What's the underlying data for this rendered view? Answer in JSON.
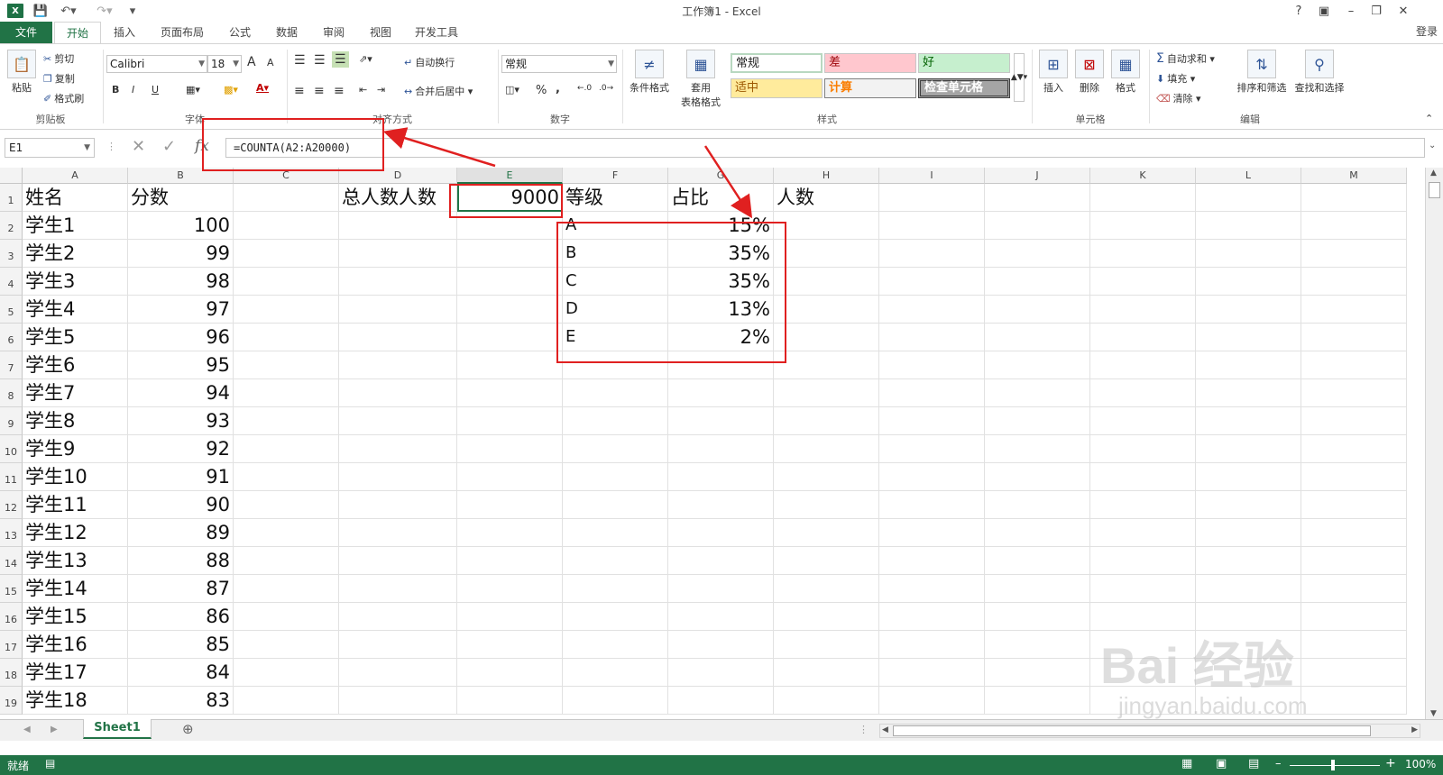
{
  "window": {
    "title": "工作簿1 - Excel",
    "help": "?",
    "login": "登录"
  },
  "ribbon_tabs": [
    "文件",
    "开始",
    "插入",
    "页面布局",
    "公式",
    "数据",
    "审阅",
    "视图",
    "开发工具"
  ],
  "clipboard": {
    "paste": "粘贴",
    "cut": "剪切",
    "copy": "复制",
    "format_painter": "格式刷",
    "label": "剪贴板"
  },
  "font": {
    "name": "Calibri",
    "size": "18",
    "grow": "A",
    "shrink": "A",
    "bold": "B",
    "italic": "I",
    "underline": "U",
    "label": "字体"
  },
  "alignment": {
    "wrap": "自动换行",
    "merge": "合并后居中",
    "label": "对齐方式"
  },
  "number": {
    "format": "常规",
    "percent": "%",
    "comma": ",",
    "label": "数字"
  },
  "styles": {
    "conditional": "条件格式",
    "table_line1": "套用",
    "table_line2": "表格格式",
    "normal": "常规",
    "bad": "差",
    "good": "好",
    "neutral": "适中",
    "calc": "计算",
    "check": "检查单元格",
    "label": "样式"
  },
  "cells_group": {
    "insert": "插入",
    "delete": "删除",
    "format": "格式",
    "label": "单元格"
  },
  "editing": {
    "autosum": "自动求和",
    "fill": "填充",
    "clear": "清除",
    "sort": "排序和筛选",
    "find": "查找和选择",
    "label": "编辑"
  },
  "formula_bar": {
    "name_box": "E1",
    "formula": "=COUNTA(A2:A20000)"
  },
  "columns": [
    "A",
    "B",
    "C",
    "D",
    "E",
    "F",
    "G",
    "H",
    "I",
    "J",
    "K",
    "L",
    "M"
  ],
  "rows": [
    "1",
    "2",
    "3",
    "4",
    "5",
    "6",
    "7",
    "8",
    "9",
    "10",
    "11",
    "12",
    "13",
    "14",
    "15",
    "16",
    "17",
    "18",
    "19"
  ],
  "sheet": {
    "A1": "姓名",
    "B1": "分数",
    "D1": "总人数人数",
    "E1": "9000",
    "F1": "等级",
    "G1": "占比",
    "H1": "人数",
    "students": [
      {
        "name": "学生1",
        "score": "100"
      },
      {
        "name": "学生2",
        "score": "99"
      },
      {
        "name": "学生3",
        "score": "98"
      },
      {
        "name": "学生4",
        "score": "97"
      },
      {
        "name": "学生5",
        "score": "96"
      },
      {
        "name": "学生6",
        "score": "95"
      },
      {
        "name": "学生7",
        "score": "94"
      },
      {
        "name": "学生8",
        "score": "93"
      },
      {
        "name": "学生9",
        "score": "92"
      },
      {
        "name": "学生10",
        "score": "91"
      },
      {
        "name": "学生11",
        "score": "90"
      },
      {
        "name": "学生12",
        "score": "89"
      },
      {
        "name": "学生13",
        "score": "88"
      },
      {
        "name": "学生14",
        "score": "87"
      },
      {
        "name": "学生15",
        "score": "86"
      },
      {
        "name": "学生16",
        "score": "85"
      },
      {
        "name": "学生17",
        "score": "84"
      },
      {
        "name": "学生18",
        "score": "83"
      }
    ],
    "grades": [
      {
        "grade": "A",
        "pct": "15%"
      },
      {
        "grade": "B",
        "pct": "35%"
      },
      {
        "grade": "C",
        "pct": "35%"
      },
      {
        "grade": "D",
        "pct": "13%"
      },
      {
        "grade": "E",
        "pct": "2%"
      }
    ]
  },
  "sheet_tab": "Sheet1",
  "status": {
    "ready": "就绪",
    "zoom": "100%"
  },
  "watermark": {
    "brand": "Bai 经验",
    "url": "jingyan.baidu.com"
  },
  "colors": {
    "excel_green": "#217346",
    "annotation_red": "#e02020"
  }
}
